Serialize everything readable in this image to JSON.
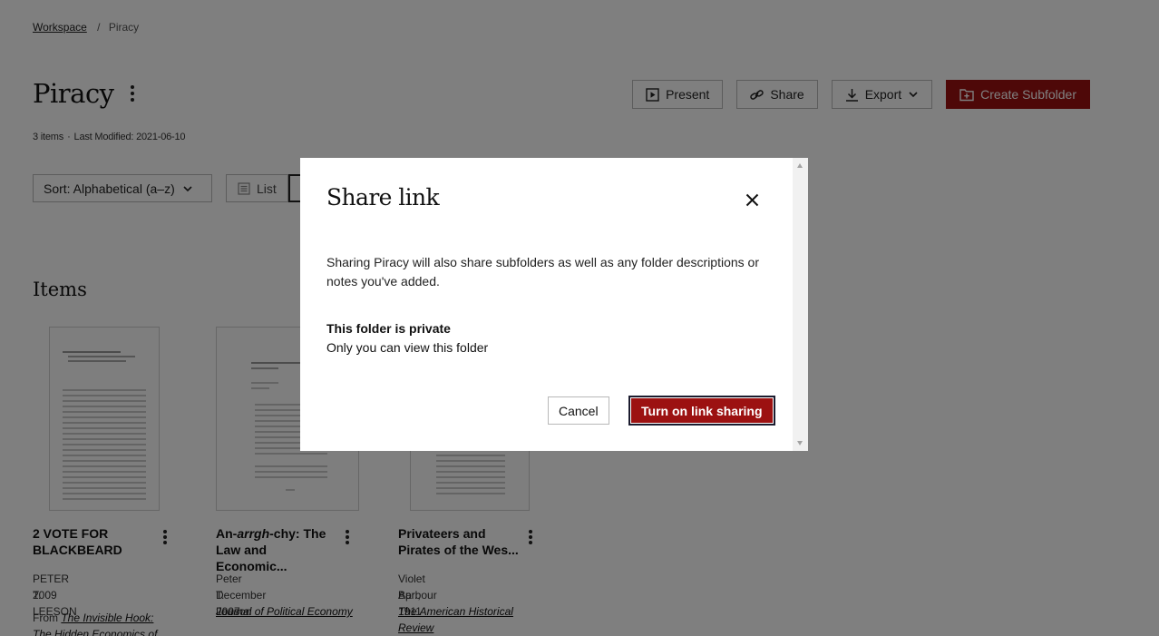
{
  "breadcrumb": {
    "workspace": "Workspace",
    "separator": "/",
    "current": "Piracy"
  },
  "header": {
    "title": "Piracy",
    "meta_items": "3 items",
    "meta_dot": "·",
    "meta_modified": "Last Modified: 2021-06-10"
  },
  "actions": {
    "present": "Present",
    "share": "Share",
    "export": "Export",
    "create_subfolder": "Create Subfolder"
  },
  "toolbar": {
    "sort": "Sort: Alphabetical (a–z)",
    "list": "List"
  },
  "items_heading": "Items",
  "items": [
    {
      "title": "2 VOTE FOR BLACKBEARD",
      "author": "PETER T. LEESON",
      "date": "2009",
      "from_prefix": "From",
      "source": "The Invisible Hook: The Hidden Economics of"
    },
    {
      "title_prefix": "An-",
      "title_em": "arrgh",
      "title_suffix": "-chy: The Law and Economic...",
      "author": "Peter T. Leeson",
      "date": "December 2007",
      "source": "Journal of Political Economy"
    },
    {
      "title": "Privateers and Pirates of the Wes...",
      "author": "Violet Barbour",
      "date": "Apr., 1911",
      "source": "The American Historical Review"
    }
  ],
  "modal": {
    "title": "Share link",
    "description": "Sharing Piracy will also share subfolders as well as any folder descriptions or notes you've added.",
    "status_title": "This folder is private",
    "status_sub": "Only you can view this folder",
    "cancel": "Cancel",
    "confirm": "Turn on link sharing"
  },
  "colors": {
    "brand_red": "#9c1111",
    "overlay": "rgba(0,0,0,0.5)"
  },
  "icons": [
    "present-icon",
    "link-icon",
    "download-icon",
    "chevron-down-icon",
    "folder-plus-icon",
    "list-icon",
    "close-icon",
    "more-vertical-icon"
  ]
}
